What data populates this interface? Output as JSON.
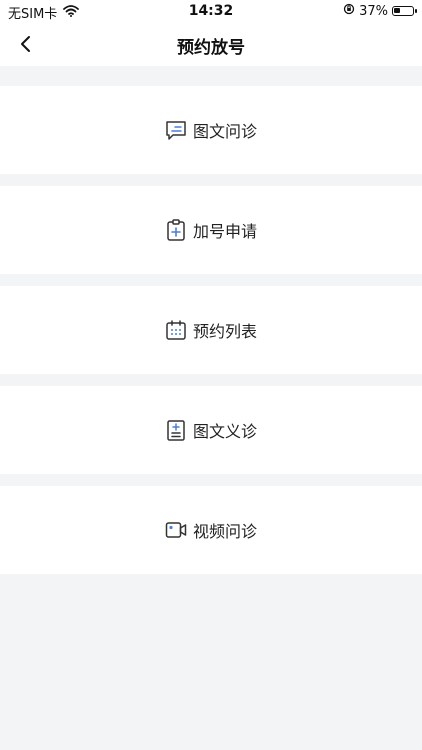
{
  "status_bar": {
    "carrier": "无SIM卡",
    "time": "14:32",
    "battery_percent": "37%",
    "battery_level": 0.37
  },
  "nav": {
    "title": "预约放号"
  },
  "menu": [
    {
      "label": "图文问诊",
      "icon": "chat-message-icon"
    },
    {
      "label": "加号申请",
      "icon": "clipboard-plus-icon"
    },
    {
      "label": "预约列表",
      "icon": "calendar-icon"
    },
    {
      "label": "图文义诊",
      "icon": "document-plus-icon"
    },
    {
      "label": "视频问诊",
      "icon": "video-camera-icon"
    }
  ],
  "colors": {
    "accent": "#4a7fd9",
    "icon_stroke": "#333333",
    "background": "#f3f4f6"
  }
}
